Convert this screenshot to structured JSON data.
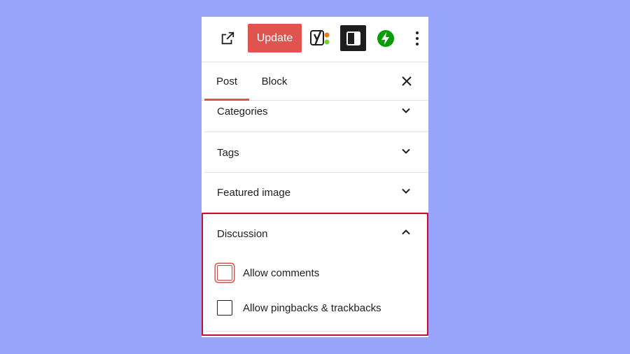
{
  "toolbar": {
    "view_post_icon": "external-link-icon",
    "update_label": "Update",
    "update_color": "#e0534f",
    "yoast_icon": "yoast-seo-icon",
    "settings_icon": "sidebar-toggle-icon",
    "jetpack_icon": "jetpack-bolt-icon",
    "more_icon": "vertical-ellipsis-icon"
  },
  "tabs": {
    "post_label": "Post",
    "block_label": "Block",
    "close_icon": "close-icon"
  },
  "sections": {
    "categories": "Categories",
    "tags": "Tags",
    "featured_image": "Featured image"
  },
  "discussion": {
    "title": "Discussion",
    "highlight_color": "#c8102e",
    "options": {
      "allow_comments": {
        "label": "Allow comments",
        "checked": false
      },
      "allow_pingbacks": {
        "label": "Allow pingbacks & trackbacks",
        "checked": false
      }
    }
  }
}
